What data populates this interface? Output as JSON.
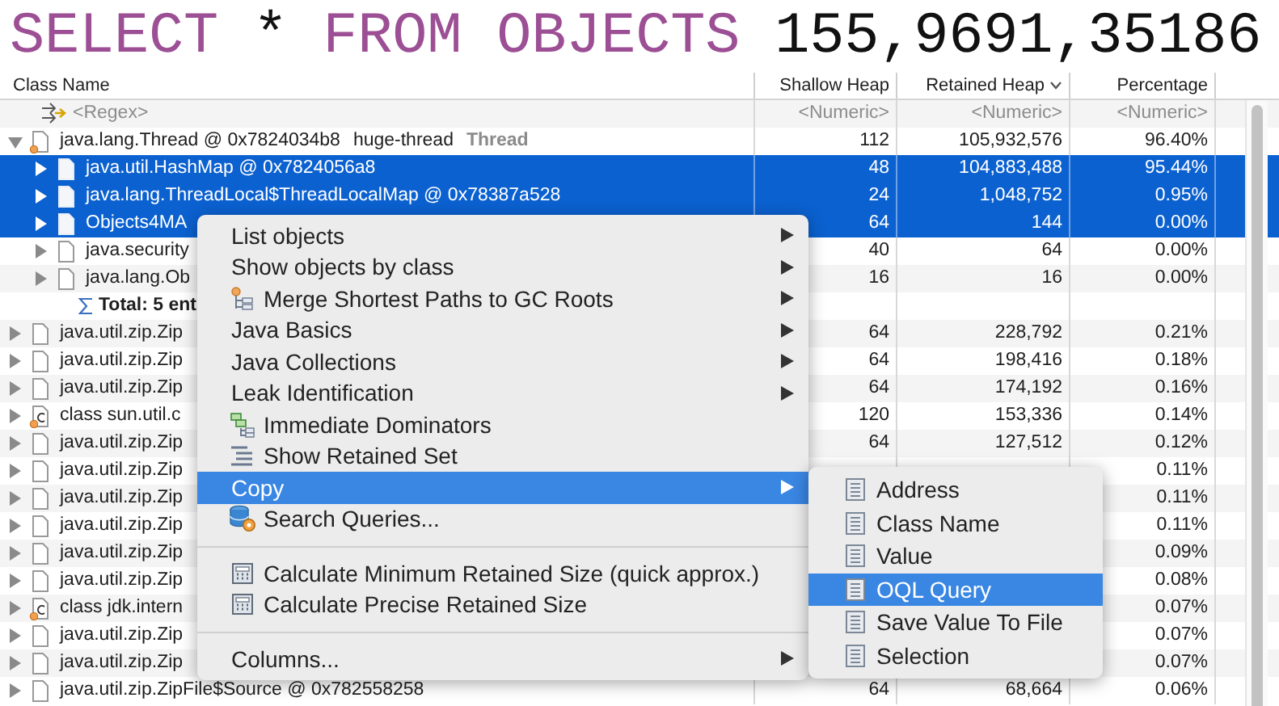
{
  "query_title": [
    {
      "text": "SELECT",
      "kind": "keyword"
    },
    {
      "text": "*",
      "kind": "plain"
    },
    {
      "text": "FROM OBJECTS",
      "kind": "keyword"
    },
    {
      "text": "155,9691,35186",
      "kind": "plain"
    }
  ],
  "table": {
    "columns": [
      {
        "label": "Class Name",
        "sorted": false
      },
      {
        "label": "Shallow Heap",
        "sorted": false
      },
      {
        "label": "Retained Heap",
        "sorted": true
      },
      {
        "label": "Percentage",
        "sorted": false
      }
    ],
    "filter": {
      "placeholder": "<Regex>",
      "numeric": [
        "<Numeric>",
        "<Numeric>",
        "<Numeric>"
      ]
    },
    "rows": [
      {
        "kind": "gc-root",
        "label": "java.lang.Thread @ 0x7824034b8",
        "name": "huge-thread",
        "type": "Thread",
        "shallow": "112",
        "retained": "105,932,576",
        "percentage": "96.40%",
        "expanded": true,
        "selected": false,
        "children": [
          {
            "kind": "object",
            "label": "java.util.HashMap @ 0x7824056a8",
            "shallow": "48",
            "retained": "104,883,488",
            "percentage": "95.44%",
            "expanded": false,
            "selected": true
          },
          {
            "kind": "object",
            "label": "java.lang.ThreadLocal$ThreadLocalMap @ 0x78387a528",
            "shallow": "24",
            "retained": "1,048,752",
            "percentage": "0.95%",
            "expanded": false,
            "selected": true
          },
          {
            "kind": "object",
            "label": "Objects4MA",
            "shallow": "64",
            "retained": "144",
            "percentage": "0.00%",
            "expanded": false,
            "selected": true
          },
          {
            "kind": "object",
            "label": "java.security",
            "shallow": "40",
            "retained": "64",
            "percentage": "0.00%",
            "expanded": false,
            "selected": false
          },
          {
            "kind": "object",
            "label": "java.lang.Ob",
            "shallow": "16",
            "retained": "16",
            "percentage": "0.00%",
            "expanded": false,
            "selected": false
          },
          {
            "kind": "total",
            "label": "Total: 5 ent"
          }
        ]
      },
      {
        "kind": "object",
        "label": "java.util.zip.Zip",
        "shallow": "64",
        "retained": "228,792",
        "percentage": "0.21%",
        "expanded": false,
        "selected": false
      },
      {
        "kind": "object",
        "label": "java.util.zip.Zip",
        "shallow": "64",
        "retained": "198,416",
        "percentage": "0.18%",
        "expanded": false,
        "selected": false
      },
      {
        "kind": "object",
        "label": "java.util.zip.Zip",
        "shallow": "64",
        "retained": "174,192",
        "percentage": "0.16%",
        "expanded": false,
        "selected": false
      },
      {
        "kind": "class",
        "label": "class sun.util.c",
        "shallow": "120",
        "retained": "153,336",
        "percentage": "0.14%",
        "expanded": false,
        "selected": false
      },
      {
        "kind": "object",
        "label": "java.util.zip.Zip",
        "shallow": "64",
        "retained": "127,512",
        "percentage": "0.12%",
        "expanded": false,
        "selected": false
      },
      {
        "kind": "object",
        "label": "java.util.zip.Zip",
        "percentage": "0.11%",
        "expanded": false,
        "selected": false
      },
      {
        "kind": "object",
        "label": "java.util.zip.Zip",
        "percentage": "0.11%",
        "expanded": false,
        "selected": false
      },
      {
        "kind": "object",
        "label": "java.util.zip.Zip",
        "percentage": "0.11%",
        "expanded": false,
        "selected": false
      },
      {
        "kind": "object",
        "label": "java.util.zip.Zip",
        "percentage": "0.09%",
        "expanded": false,
        "selected": false
      },
      {
        "kind": "object",
        "label": "java.util.zip.Zip",
        "percentage": "0.08%",
        "expanded": false,
        "selected": false
      },
      {
        "kind": "class",
        "label": "class jdk.intern",
        "percentage": "0.07%",
        "expanded": false,
        "selected": false
      },
      {
        "kind": "object",
        "label": "java.util.zip.Zip",
        "percentage": "0.07%",
        "expanded": false,
        "selected": false
      },
      {
        "kind": "object",
        "label": "java.util.zip.Zip",
        "percentage": "0.07%",
        "expanded": false,
        "selected": false
      },
      {
        "kind": "object",
        "label": "java.util.zip.ZipFile$Source @ 0x782558258",
        "shallow": "64",
        "retained": "68,664",
        "percentage": "0.06%",
        "expanded": false,
        "selected": false
      }
    ]
  },
  "context_menu": {
    "items": [
      {
        "kind": "plain",
        "label": "List objects",
        "submenu": true,
        "selected": false
      },
      {
        "kind": "plain",
        "label": "Show objects by class",
        "submenu": true,
        "selected": false
      },
      {
        "kind": "paths",
        "label": "Merge Shortest Paths to GC Roots",
        "submenu": true,
        "selected": false
      },
      {
        "kind": "plain",
        "label": "Java Basics",
        "submenu": true,
        "selected": false
      },
      {
        "kind": "plain",
        "label": "Java Collections",
        "submenu": true,
        "selected": false
      },
      {
        "kind": "plain",
        "label": "Leak Identification",
        "submenu": true,
        "selected": false
      },
      {
        "kind": "dominators",
        "label": "Immediate Dominators",
        "submenu": false,
        "selected": false
      },
      {
        "kind": "retained",
        "label": "Show Retained Set",
        "submenu": false,
        "selected": false
      },
      {
        "kind": "plain",
        "label": "Copy",
        "submenu": true,
        "selected": true
      },
      {
        "kind": "queries",
        "label": "Search Queries...",
        "submenu": false,
        "selected": false
      },
      {
        "kind": "separator"
      },
      {
        "kind": "calculate",
        "label": "Calculate Minimum Retained Size (quick approx.)",
        "submenu": false,
        "selected": false
      },
      {
        "kind": "calculate",
        "label": "Calculate Precise Retained Size",
        "submenu": false,
        "selected": false
      },
      {
        "kind": "separator"
      },
      {
        "kind": "plain",
        "label": "Columns...",
        "submenu": true,
        "selected": false
      }
    ]
  },
  "copy_submenu": {
    "items": [
      {
        "label": "Address",
        "selected": false
      },
      {
        "label": "Class Name",
        "selected": false
      },
      {
        "label": "Value",
        "selected": false
      },
      {
        "label": "OQL Query",
        "selected": true
      },
      {
        "label": "Save Value To File",
        "selected": false
      },
      {
        "label": "Selection",
        "selected": false
      }
    ]
  }
}
